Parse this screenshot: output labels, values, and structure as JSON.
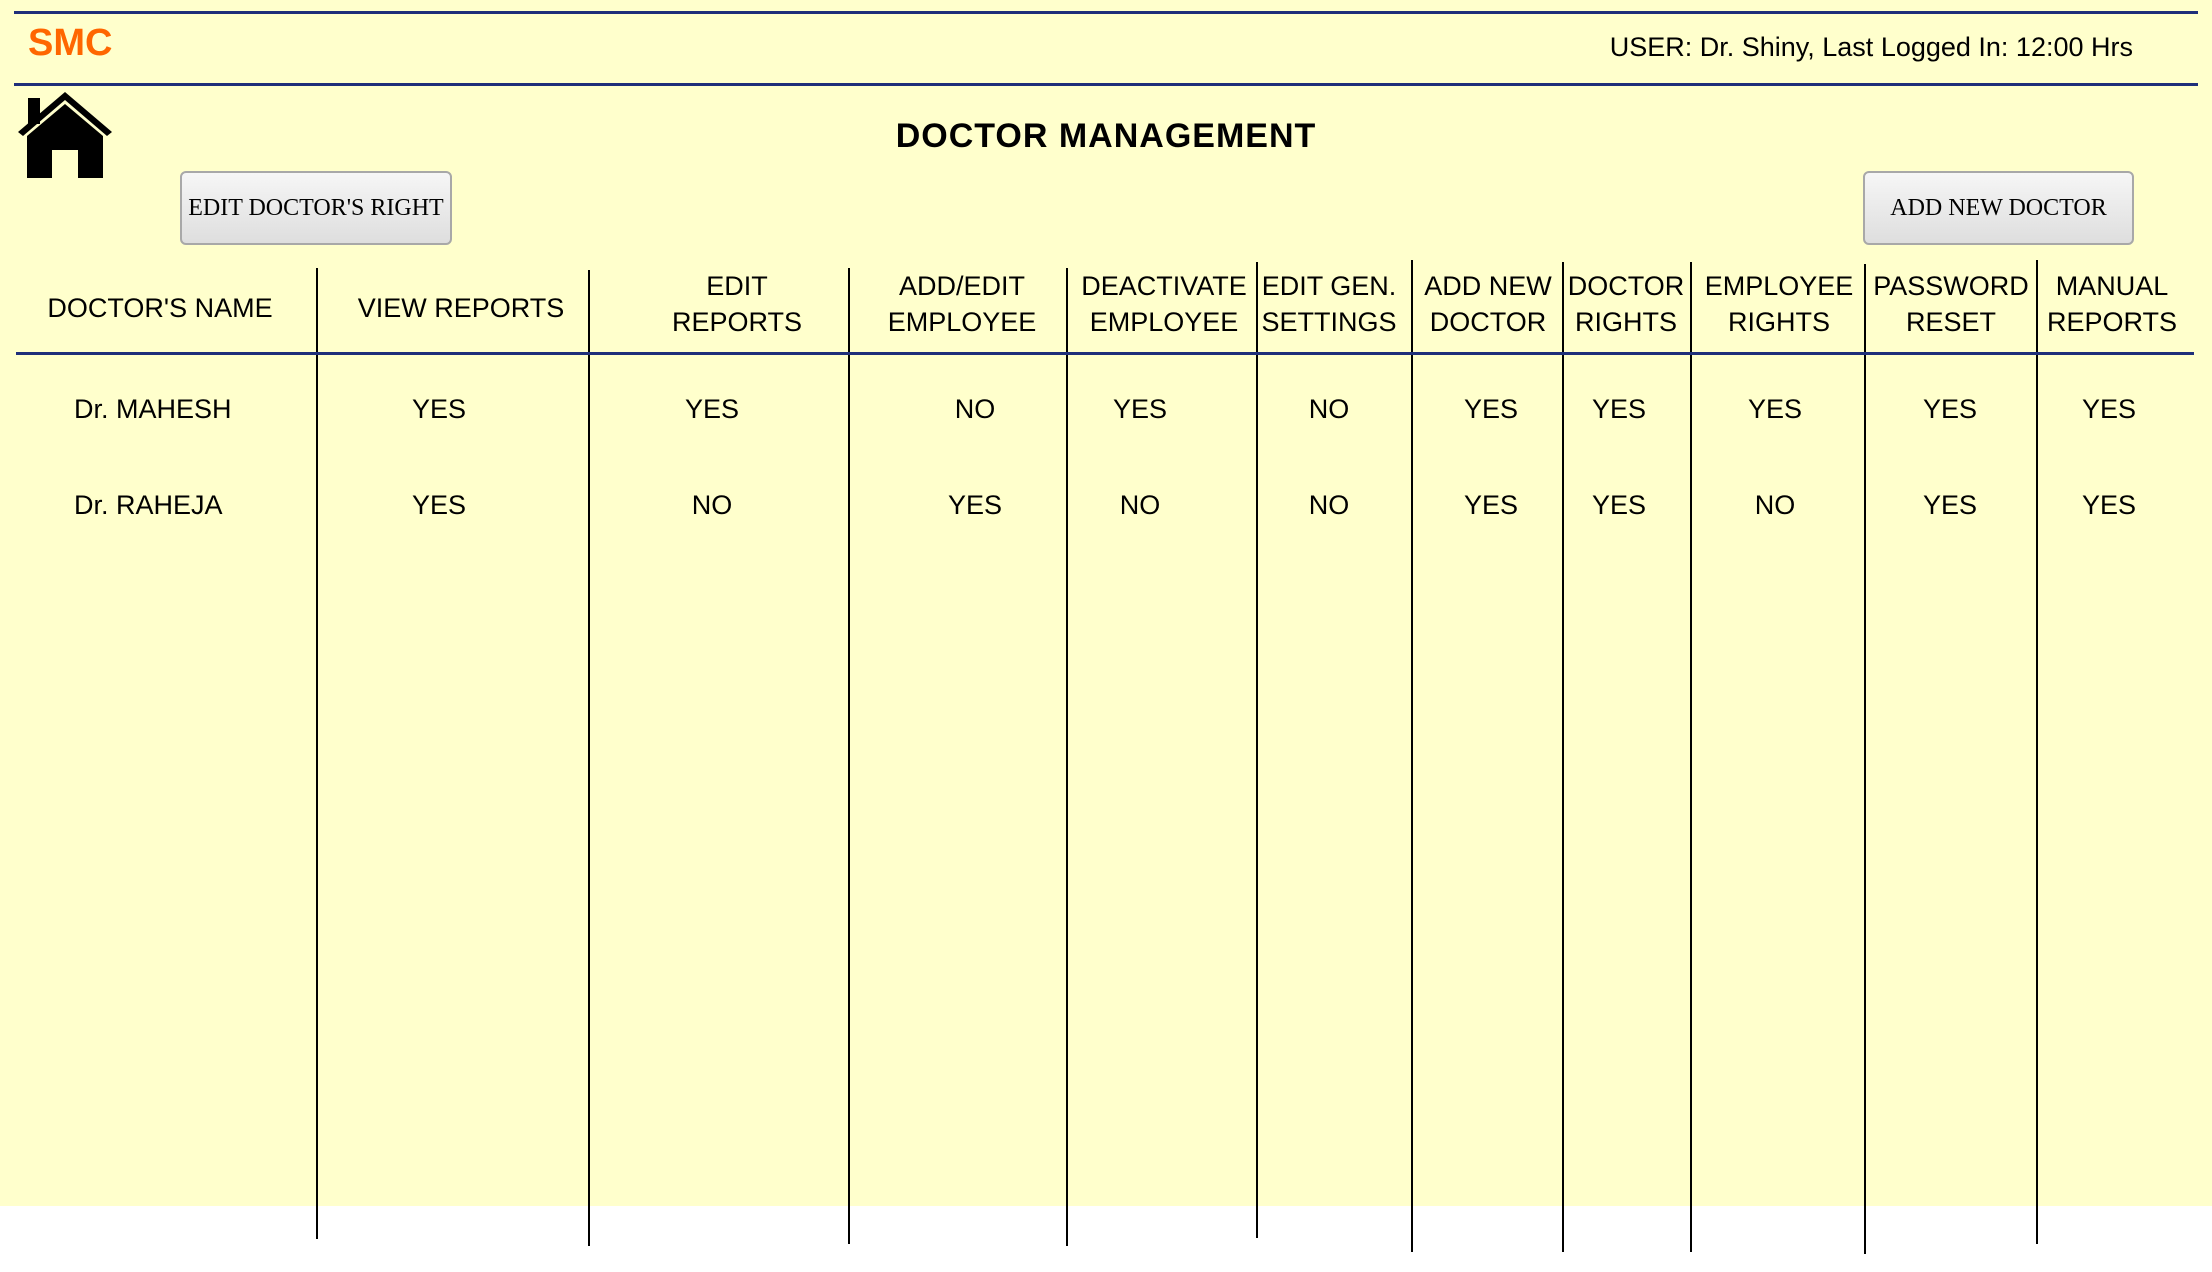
{
  "app": {
    "brand": "SMC",
    "user_info": "USER: Dr. Shiny, Last Logged In: 12:00 Hrs"
  },
  "page": {
    "title": "DOCTOR MANAGEMENT"
  },
  "toolbar": {
    "edit_rights_label": "EDIT DOCTOR'S RIGHT",
    "add_doctor_label": "ADD NEW DOCTOR"
  },
  "icons": {
    "home": "home-icon"
  },
  "colors": {
    "background": "#ffffcc",
    "brand": "#ff6600",
    "rule": "#1f2f7a"
  },
  "table": {
    "headers": [
      {
        "line1": "DOCTOR'S   NAME",
        "line2": ""
      },
      {
        "line1": "VIEW REPORTS",
        "line2": ""
      },
      {
        "line1": "EDIT",
        "line2": "REPORTS"
      },
      {
        "line1": "ADD/EDIT",
        "line2": "EMPLOYEE"
      },
      {
        "line1": "DEACTIVATE",
        "line2": "EMPLOYEE"
      },
      {
        "line1": "EDIT GEN.",
        "line2": "SETTINGS"
      },
      {
        "line1": "ADD NEW",
        "line2": "DOCTOR"
      },
      {
        "line1": "DOCTOR",
        "line2": "RIGHTS"
      },
      {
        "line1": "EMPLOYEE",
        "line2": "RIGHTS"
      },
      {
        "line1": "PASSWORD",
        "line2": "RESET"
      },
      {
        "line1": "MANUAL",
        "line2": "REPORTS"
      }
    ],
    "rows": [
      {
        "name": "Dr. MAHESH",
        "values": [
          "YES",
          "YES",
          "NO",
          "YES",
          "NO",
          "YES",
          "YES",
          "YES",
          "YES",
          "YES"
        ]
      },
      {
        "name": "Dr. RAHEJA",
        "values": [
          "YES",
          "NO",
          "YES",
          "NO",
          "NO",
          "YES",
          "YES",
          "NO",
          "YES",
          "YES"
        ]
      }
    ]
  }
}
